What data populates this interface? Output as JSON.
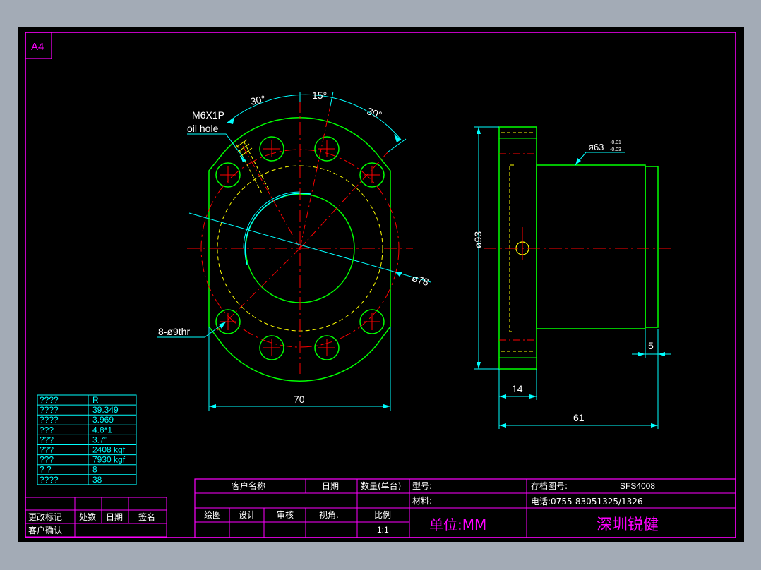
{
  "sheet": {
    "size_label": "A4"
  },
  "front_view": {
    "angle_left": "30°",
    "angle_top": "15°",
    "angle_right": "30°",
    "oil_hole_thread": "M6X1P",
    "oil_hole_label": "oil hole",
    "pcd_dim": "ø78",
    "holes_dim": "8-ø9thr",
    "width_dim": "70"
  },
  "side_view": {
    "spigot_dim": "ø63",
    "spigot_tol_upper": "-0.01",
    "spigot_tol_lower": "-0.03",
    "outer_dim": "ø93",
    "step_dim": "5",
    "flange_dim": "14",
    "length_dim": "61"
  },
  "spec_table": {
    "rows": [
      [
        "????",
        "R"
      ],
      [
        "????",
        "39.349"
      ],
      [
        "????",
        "3.969"
      ],
      [
        " ???",
        "4.8*1"
      ],
      [
        " ???",
        "3.7°"
      ],
      [
        " ???",
        "2408 kgf"
      ],
      [
        " ???",
        "7930 kgf"
      ],
      [
        " ?  ?",
        "8"
      ],
      [
        "????",
        "38"
      ]
    ]
  },
  "title_block": {
    "customer_name": "客户名称",
    "date": "日期",
    "qty": "数量(单台)",
    "model_label": "型号:",
    "material_label": "材料:",
    "drawing_no_label": "存档图号:",
    "drawing_no": "SFS4008",
    "phone": "电话:0755-83051325/1326",
    "drawn": "绘图",
    "design": "设计",
    "review": "审核",
    "view_angle": "视角.",
    "scale_label": "比例",
    "scale_value": "1:1",
    "unit": "单位:MM",
    "company": "深圳锐健"
  },
  "revision_block": {
    "change_mark": "更改标记",
    "place_count": "处数",
    "date": "日期",
    "signature": "签名",
    "customer_confirm": "客户确认"
  },
  "colors": {
    "background": "#000000",
    "frame": "#ff00ff",
    "outline": "#00ff00",
    "dimension": "#00ffff",
    "center_line": "#ff0000",
    "hidden_line": "#ffff00",
    "text": "#ffffff",
    "spigot_face": "#008000"
  }
}
